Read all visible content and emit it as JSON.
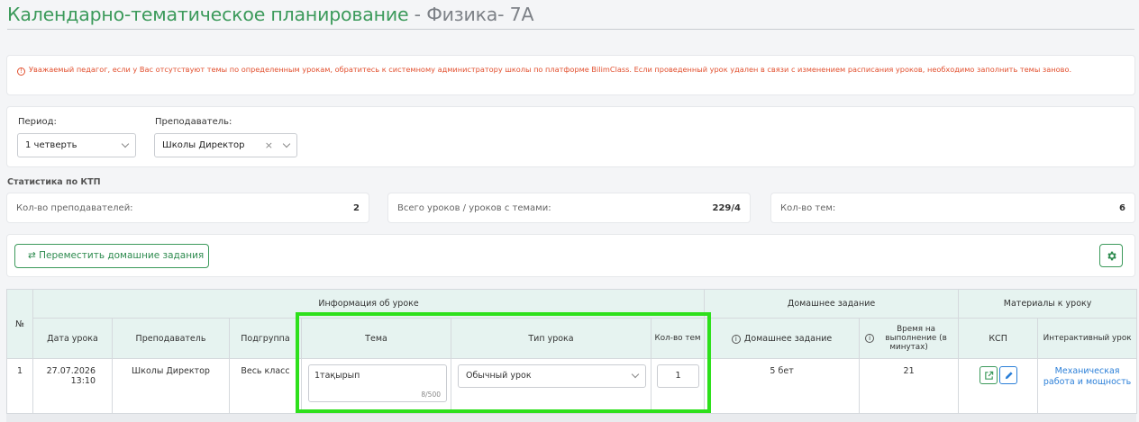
{
  "page": {
    "title": "Календарно-тематическое планирование",
    "title_sep": " - ",
    "subtitle": "Физика- 7А"
  },
  "notice": {
    "text": "Уважаемый педагог, если у Вас отсутствуют темы по определенным урокам, обратитесь к системному администратору школы по платформе BilimClass. Если проведенный урок удален в связи с изменением расписания уроков, необходимо заполнить темы заново.",
    "color": "#e2502f"
  },
  "filters": {
    "period_label": "Период:",
    "period_value": "1 четверть",
    "teacher_label": "Преподаватель:",
    "teacher_value": "Школы Директор",
    "clear_glyph": "×"
  },
  "stats": {
    "title": "Статистика по КТП",
    "teachers_label": "Кол-во преподавателей:",
    "teachers_value": "2",
    "lessons_label": "Всего уроков / уроков с темами:",
    "lessons_value": "229/4",
    "topics_label": "Кол-во тем:",
    "topics_value": "6"
  },
  "actions": {
    "move_homework_glyph": "⇄",
    "move_homework_label": "Переместить домашние задания"
  },
  "table": {
    "headers": {
      "num": "№",
      "group_info": "Информация об уроке",
      "group_homework": "Домашнее задание",
      "group_materials": "Материалы к уроку",
      "date": "Дата урока",
      "teacher": "Преподаватель",
      "subgroup": "Подгруппа",
      "topic": "Тема",
      "type": "Тип урока",
      "count": "Кол-во тем",
      "homework": "Домашнее задание",
      "time": "Время на выполнение (в минутах)",
      "kcp": "КСП",
      "interactive": "Интерактивный урок"
    },
    "row": {
      "num": "1",
      "date": "27.07.2026",
      "time_of_day": "13:10",
      "teacher": "Школы Директор",
      "subgroup": "Весь класс",
      "topic": "1тақырып",
      "topic_counter": "8/500",
      "type": "Обычный урок",
      "count": "1",
      "homework": "5 бет",
      "time": "21",
      "interactive": "Механическая работа и мощность"
    }
  },
  "colors": {
    "accent_green": "#3c9a5b",
    "header_bg": "#e6f3f0",
    "highlight": "#2ee01c",
    "link": "#2b7fd8"
  }
}
